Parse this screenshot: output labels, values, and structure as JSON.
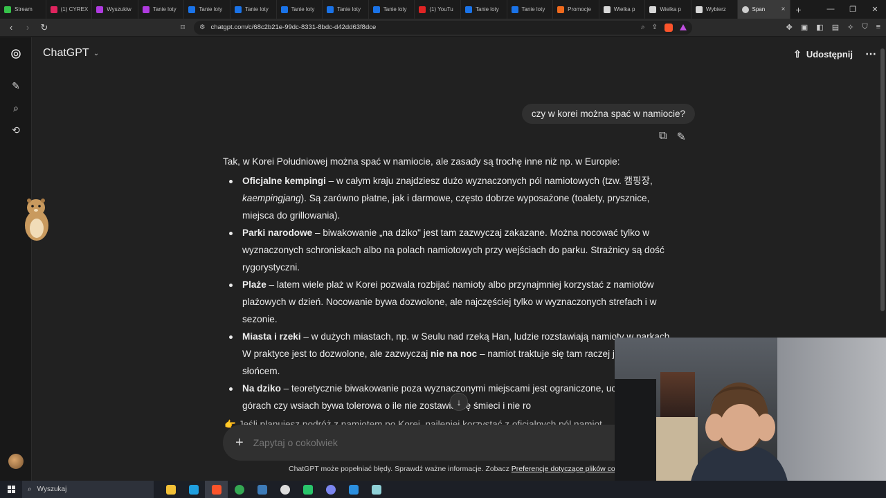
{
  "browser": {
    "tabs": [
      {
        "label": "Stream",
        "color": "#36c24a"
      },
      {
        "label": "(1) CYREX",
        "color": "#e0245e"
      },
      {
        "label": "Wyszukiw",
        "color": "#b03be0"
      },
      {
        "label": "Tanie loty",
        "color": "#b03be0"
      },
      {
        "label": "Tanie loty",
        "color": "#1a73e8"
      },
      {
        "label": "Tanie loty",
        "color": "#1a73e8"
      },
      {
        "label": "Tanie loty",
        "color": "#1a73e8"
      },
      {
        "label": "Tanie loty",
        "color": "#1a73e8"
      },
      {
        "label": "Tanie loty",
        "color": "#1a73e8"
      },
      {
        "label": "(1) YouTu",
        "color": "#e02424"
      },
      {
        "label": "Tanie loty",
        "color": "#1a73e8"
      },
      {
        "label": "Tanie loty",
        "color": "#1a73e8"
      },
      {
        "label": "Promocje",
        "color": "#f06a1d"
      },
      {
        "label": "Wielka p",
        "color": "#d8d8d8"
      },
      {
        "label": "Wielka p",
        "color": "#d8d8d8"
      },
      {
        "label": "Wybierz",
        "color": "#d8d8d8"
      }
    ],
    "active_tab": {
      "label": "Span"
    },
    "url": "chatgpt.com/c/68c2b21e-99dc-8331-8bdc-d42dd63f8dce"
  },
  "app": {
    "title": "ChatGPT",
    "share_label": "Udostępnij"
  },
  "conversation": {
    "user_message": "czy w korei można spać w namiocie?",
    "answer": {
      "intro": "Tak, w Korei Południowej można spać w namiocie, ale zasady są trochę inne niż np. w Europie:",
      "items": [
        {
          "title": "Oficjalne kempingi",
          "text": " – w całym kraju znajdziesz dużo wyznaczonych pól namiotowych (tzw. 캠핑장, ",
          "italic": "kaempingjang",
          "text2": "). Są zarówno płatne, jak i darmowe, często dobrze wyposażone (toalety, prysznice, miejsca do grillowania)."
        },
        {
          "title": "Parki narodowe",
          "text": " – biwakowanie „na dziko\" jest tam zazwyczaj zakazane. Można nocować tylko w wyznaczonych schroniskach albo na polach namiotowych przy wejściach do parku. Strażnicy są dość rygorystyczni."
        },
        {
          "title": "Plaże",
          "text": " – latem wiele plaż w Korei pozwala rozbijać namioty albo przynajmniej korzystać z namiotów plażowych w dzień. Nocowanie bywa dozwolone, ale najczęściej tylko w wyznaczonych strefach i w sezonie."
        },
        {
          "title": "Miasta i rzeki",
          "text": " – w dużych miastach, np. w Seulu nad rzeką Han, ludzie rozstawiają namioty w parkach. W praktyce jest to dozwolone, ale zazwyczaj ",
          "bold2": "nie na noc",
          "text2": " – namiot traktuje się tam raczej j"
        },
        {
          "title": "Na dziko",
          "text": " – teoretycznie biwakowanie poza wyznaczonymi miejscami jest ograniczone, uczęszczanych górach czy wsiach bywa tolerowa o ile nie zostawia się śmieci i nie ro"
        }
      ],
      "items_extra": "słońcem.",
      "tail": "👉 Jeśli planujesz podróż z namiotem po Korei, najlepiej korzystać z oficjalnych pól namiot"
    }
  },
  "composer": {
    "placeholder": "Zapytaj o cokolwiek"
  },
  "disclaimer": {
    "text": "ChatGPT może popełniać błędy. Sprawdź ważne informacje. Zobacz ",
    "link": "Preferencje dotyczące plików co"
  },
  "taskbar": {
    "search_placeholder": "Wyszukaj",
    "apps": [
      {
        "name": "file-explorer",
        "color": "#f2c037"
      },
      {
        "name": "edge",
        "color": "#1f9fe0"
      },
      {
        "name": "brave",
        "color": "#fb542b"
      },
      {
        "name": "chrome",
        "color": "#34a853"
      },
      {
        "name": "steam",
        "color": "#3d7bb8"
      },
      {
        "name": "obs",
        "color": "#dddddd"
      },
      {
        "name": "media",
        "color": "#29c56b"
      },
      {
        "name": "discord",
        "color": "#7b86f0"
      },
      {
        "name": "mail",
        "color": "#2b8fe0"
      },
      {
        "name": "notepad",
        "color": "#8fd1d8"
      }
    ]
  }
}
